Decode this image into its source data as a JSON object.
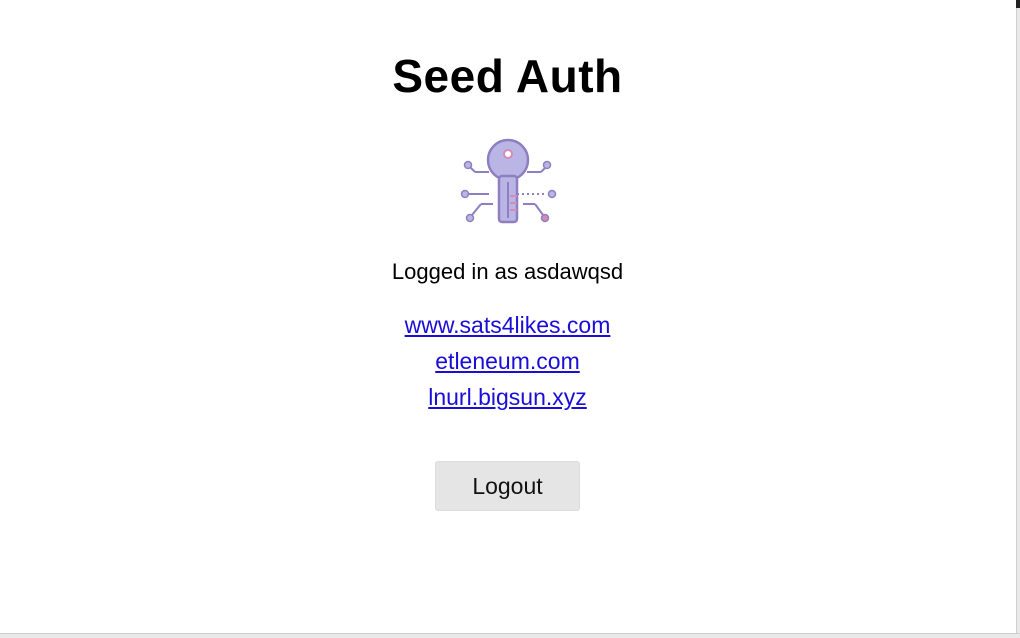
{
  "header": {
    "title": "Seed Auth"
  },
  "logo": {
    "icon": "key-network-icon",
    "colors": {
      "fill": "#b9b6e6",
      "stroke": "#8f7fc0",
      "accent": "#d58ab8"
    }
  },
  "status": {
    "text": "Logged in as asdawqsd"
  },
  "links": [
    {
      "label": "www.sats4likes.com"
    },
    {
      "label": "etleneum.com"
    },
    {
      "label": "lnurl.bigsun.xyz"
    }
  ],
  "actions": {
    "logout_label": "Logout"
  },
  "colors": {
    "link": "#1a0dd8",
    "button_bg": "#e5e5e5"
  }
}
